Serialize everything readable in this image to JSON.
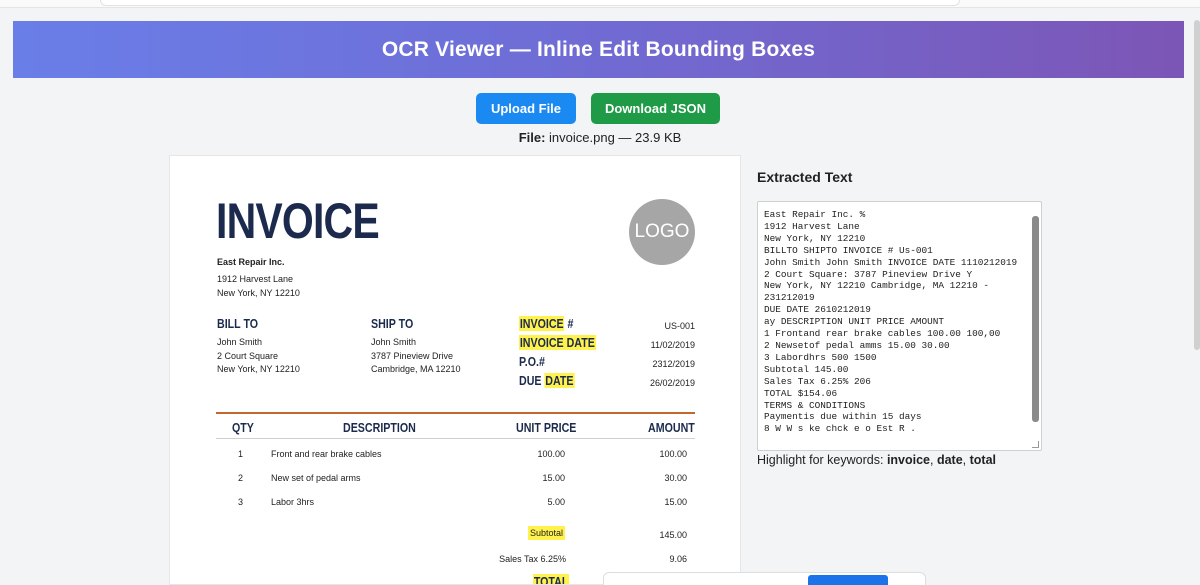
{
  "app": {
    "title": "OCR Viewer — Inline Edit Bounding Boxes"
  },
  "toolbar": {
    "upload_label": "Upload File",
    "download_label": "Download JSON"
  },
  "file": {
    "label": "File:",
    "value": "invoice.png — 23.9 KB"
  },
  "invoice": {
    "title": "INVOICE",
    "logo": "LOGO",
    "company": {
      "name": "East Repair Inc.",
      "street": "1912 Harvest Lane",
      "city": "New York, NY 12210"
    },
    "bill_to": {
      "heading": "BILL TO",
      "name": "John Smith",
      "street": "2 Court Square",
      "city": "New York, NY 12210"
    },
    "ship_to": {
      "heading": "SHIP TO",
      "name": "John Smith",
      "street": "3787 Pineview Drive",
      "city": "Cambridge, MA 12210"
    },
    "meta": [
      {
        "label_hl": "INVOICE",
        "label_rest": " #",
        "value": "US-001"
      },
      {
        "label_hl": "INVOICE DATE",
        "label_rest": "",
        "value": "11/02/2019"
      },
      {
        "label_hl": "",
        "label_rest": "P.O.#",
        "value": "2312/2019"
      },
      {
        "label_hl": "DATE",
        "label_pre": "DUE ",
        "label_rest": "",
        "value": "26/02/2019"
      }
    ],
    "columns": {
      "qty": "QTY",
      "description": "DESCRIPTION",
      "unit_price": "UNIT PRICE",
      "amount": "AMOUNT"
    },
    "items": [
      {
        "qty": "1",
        "description": "Front and rear brake cables",
        "unit_price": "100.00",
        "amount": "100.00"
      },
      {
        "qty": "2",
        "description": "New set of pedal arms",
        "unit_price": "15.00",
        "amount": "30.00"
      },
      {
        "qty": "3",
        "description": "Labor 3hrs",
        "unit_price": "5.00",
        "amount": "15.00"
      }
    ],
    "subtotal": {
      "label": "Subtotal",
      "value": "145.00"
    },
    "tax": {
      "label": "Sales Tax 6.25%",
      "value": "9.06"
    },
    "total": {
      "label": "TOTAL"
    }
  },
  "extracted": {
    "title": "Extracted Text",
    "text": "East Repair Inc. %\n1912 Harvest Lane\nNew York, NY 12210\nBILLTO SHIPTO INVOICE # Us-001\nJohn Smith John Smith INVOICE DATE 1110212019\n2 Court Square: 3787 Pineview Drive Y\nNew York, NY 12210 Cambridge, MA 12210 -\n231212019\nDUE DATE 2610212019\nay DESCRIPTION UNIT PRICE AMOUNT\n1 Frontand rear brake cables 100.00 100,00\n2 Newsetof pedal amms 15.00 30.00\n3 Labordhrs 500 1500\nSubtotal 145.00\nSales Tax 6.25% 206\nTOTAL $154.06\nTERMS & CONDITIONS\nPaymentis due within 15 days\n8 W W s ke chck e o Est R ."
  },
  "keywords": {
    "label": "Highlight for keywords:",
    "k1": "invoice",
    "k2": "date",
    "k3": "total",
    "sep": ", "
  },
  "colors": {
    "accent_blue": "#1a8af2",
    "accent_green": "#1f9a47",
    "highlight": "#fff24d",
    "invoice_navy": "#1c2b4d",
    "rule_orange": "#c4662f"
  }
}
